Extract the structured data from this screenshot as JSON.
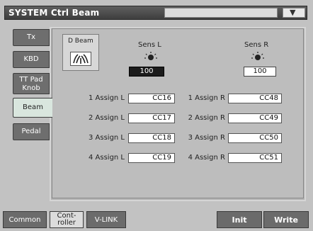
{
  "title": "SYSTEM Ctrl Beam",
  "tabs": [
    {
      "label": "Tx"
    },
    {
      "label": "KBD"
    },
    {
      "label_line1": "TT Pad",
      "label_line2": "Knob"
    },
    {
      "label": "Beam"
    },
    {
      "label": "Pedal"
    }
  ],
  "dbeam": {
    "label": "D Beam"
  },
  "sens_l": {
    "label": "Sens L",
    "value": "100"
  },
  "sens_r": {
    "label": "Sens R",
    "value": "100"
  },
  "assign_left": [
    {
      "label": "1 Assign L",
      "value": "CC16"
    },
    {
      "label": "2 Assign L",
      "value": "CC17"
    },
    {
      "label": "3 Assign L",
      "value": "CC18"
    },
    {
      "label": "4 Assign L",
      "value": "CC19"
    }
  ],
  "assign_right": [
    {
      "label": "1 Assign R",
      "value": "CC48"
    },
    {
      "label": "2 Assign R",
      "value": "CC49"
    },
    {
      "label": "3 Assign R",
      "value": "CC50"
    },
    {
      "label": "4 Assign R",
      "value": "CC51"
    }
  ],
  "bottom": {
    "common": "Common",
    "controller_line1": "Cont-",
    "controller_line2": "roller",
    "vlink": "V-LINK",
    "init": "Init",
    "write": "Write"
  },
  "icons": {
    "dropdown": "chevron-down-icon",
    "dbeam": "dbeam-wave-icon",
    "knob": "knob-icon"
  }
}
